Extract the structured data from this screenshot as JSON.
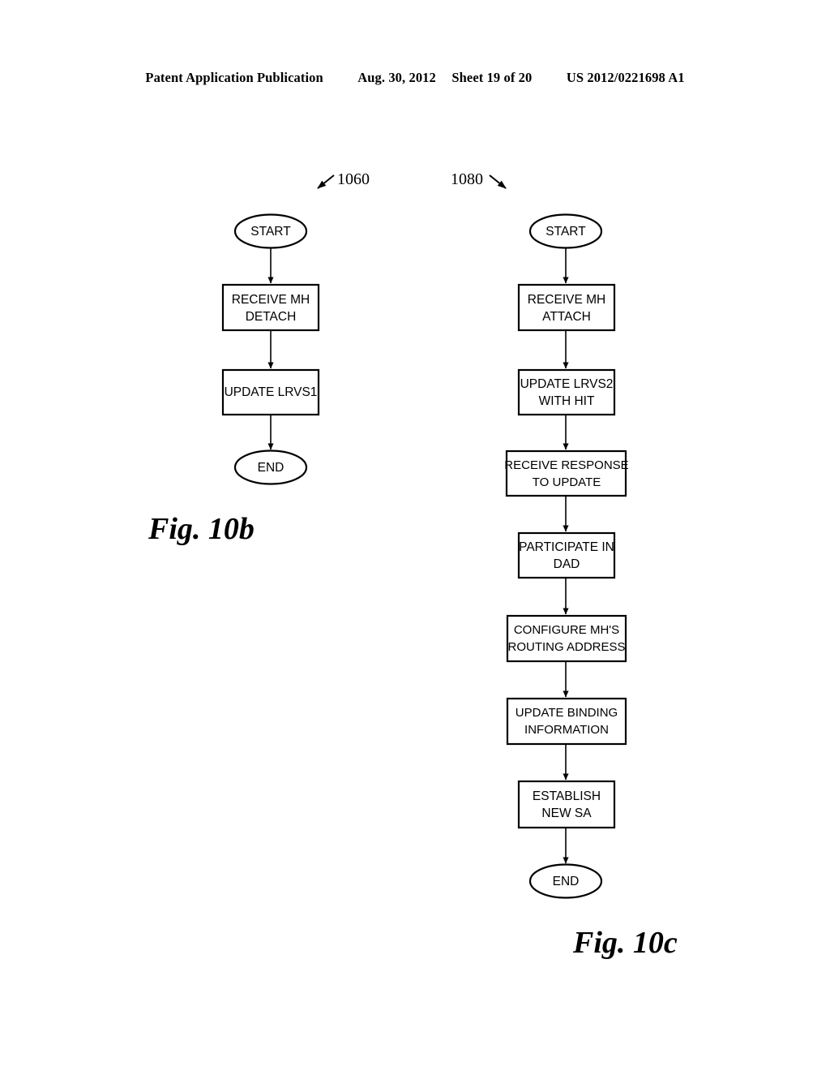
{
  "header": {
    "publication": "Patent Application Publication",
    "date": "Aug. 30, 2012",
    "sheet": "Sheet 19 of 20",
    "patent_number": "US 2012/0221698 A1"
  },
  "figures": [
    {
      "id": "fig-10b",
      "caption": "Fig. 10b",
      "reference_numeral": "1060",
      "nodes": [
        {
          "type": "terminator",
          "label_lines": [
            "START"
          ]
        },
        {
          "type": "process",
          "label_lines": [
            "RECEIVE MH",
            "DETACH"
          ]
        },
        {
          "type": "process",
          "label_lines": [
            "UPDATE LRVS1"
          ]
        },
        {
          "type": "terminator",
          "label_lines": [
            "END"
          ]
        }
      ]
    },
    {
      "id": "fig-10c",
      "caption": "Fig. 10c",
      "reference_numeral": "1080",
      "nodes": [
        {
          "type": "terminator",
          "label_lines": [
            "START"
          ]
        },
        {
          "type": "process",
          "label_lines": [
            "RECEIVE MH",
            "ATTACH"
          ]
        },
        {
          "type": "process",
          "label_lines": [
            "UPDATE LRVS2",
            "WITH HIT"
          ]
        },
        {
          "type": "process",
          "label_lines": [
            "RECEIVE RESPONSE",
            "TO UPDATE"
          ]
        },
        {
          "type": "process",
          "label_lines": [
            "PARTICIPATE IN",
            "DAD"
          ]
        },
        {
          "type": "process",
          "label_lines": [
            "CONFIGURE MH'S",
            "ROUTING ADDRESS"
          ]
        },
        {
          "type": "process",
          "label_lines": [
            "UPDATE BINDING",
            "INFORMATION"
          ]
        },
        {
          "type": "process",
          "label_lines": [
            "ESTABLISH",
            "NEW SA"
          ]
        },
        {
          "type": "terminator",
          "label_lines": [
            "END"
          ]
        }
      ]
    }
  ],
  "flow_10b": {
    "start": "START",
    "step1_line1": "RECEIVE MH",
    "step1_line2": "DETACH",
    "step2_line1": "UPDATE LRVS1",
    "end": "END"
  },
  "flow_10c": {
    "start": "START",
    "step1_line1": "RECEIVE MH",
    "step1_line2": "ATTACH",
    "step2_line1": "UPDATE LRVS2",
    "step2_line2": "WITH HIT",
    "step3_line1": "RECEIVE RESPONSE",
    "step3_line2": "TO UPDATE",
    "step4_line1": "PARTICIPATE IN",
    "step4_line2": "DAD",
    "step5_line1": "CONFIGURE MH'S",
    "step5_line2": "ROUTING ADDRESS",
    "step6_line1": "UPDATE BINDING",
    "step6_line2": "INFORMATION",
    "step7_line1": "ESTABLISH",
    "step7_line2": "NEW SA",
    "end": "END"
  },
  "colors": {
    "ink": "#000000",
    "paper": "#ffffff"
  }
}
